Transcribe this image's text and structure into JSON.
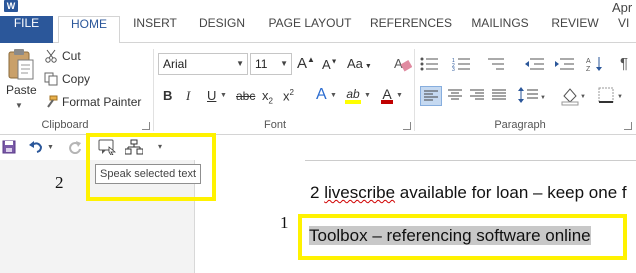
{
  "window": {
    "app_icon": "W",
    "title_fragment": "Apr"
  },
  "tabs": [
    "FILE",
    "HOME",
    "INSERT",
    "DESIGN",
    "PAGE LAYOUT",
    "REFERENCES",
    "MAILINGS",
    "REVIEW",
    "VI"
  ],
  "clipboard": {
    "paste_label": "Paste",
    "cut_label": "Cut",
    "copy_label": "Copy",
    "format_painter_label": "Format Painter",
    "group_label": "Clipboard"
  },
  "font": {
    "font_name": "Arial",
    "font_size": "11",
    "bold": "B",
    "italic": "I",
    "underline": "U",
    "strikethrough": "abc",
    "subscript": "x",
    "subscript_mark": "2",
    "superscript": "x",
    "superscript_mark": "2",
    "grow": "A",
    "shrink": "A",
    "case": "Aa",
    "text_effects": "A",
    "highlight": "ab",
    "font_color": "A",
    "group_label": "Font"
  },
  "paragraph": {
    "group_label": "Paragraph",
    "pilcrow": "¶"
  },
  "qat": {
    "tooltip": "Speak selected text"
  },
  "annotations": {
    "marker_1": "1",
    "marker_2": "2"
  },
  "document": {
    "line1_prefix": "2 ",
    "line1_word": "livescribe",
    "line1_rest": " available for loan – keep one f",
    "line2_selected": "Toolbox – referencing software online"
  },
  "colors": {
    "file_tab": "#2b579a",
    "highlight_box": "#fff200",
    "font_color_underline": "#c00000",
    "highlight_color": "#ffff00"
  }
}
